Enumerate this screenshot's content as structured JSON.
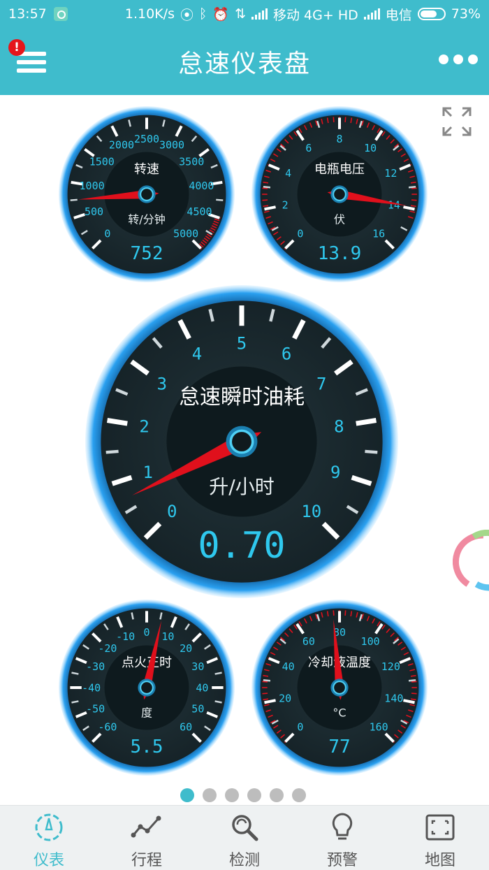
{
  "status_bar": {
    "time": "13:57",
    "net_speed": "1.10K/s",
    "carrier1": "移动 4G+ HD",
    "carrier2": "电信",
    "battery_pct": "73%",
    "battery_level": 0.73
  },
  "header": {
    "title": "怠速仪表盘",
    "notification_badge": "!"
  },
  "gauges": [
    {
      "id": "rpm",
      "label": "转速",
      "unit": "转/分钟",
      "reading": "752",
      "value": 752,
      "min": 0,
      "max": 5000,
      "ticks": [
        "0",
        "500",
        "1000",
        "1500",
        "2000",
        "2500",
        "3000",
        "3500",
        "4000",
        "4500",
        "5000"
      ],
      "redzone_from": 4500
    },
    {
      "id": "voltage",
      "label": "电瓶电压",
      "unit": "伏",
      "reading": "13.9",
      "value": 13.9,
      "min": 0,
      "max": 16,
      "ticks": [
        "0",
        "2",
        "4",
        "6",
        "8",
        "10",
        "12",
        "14",
        "16"
      ],
      "redzone_from": 0
    },
    {
      "id": "fuel",
      "label": "怠速瞬时油耗",
      "unit": "升/小时",
      "reading": "0.70",
      "value": 0.7,
      "min": 0,
      "max": 10,
      "ticks": [
        "0",
        "1",
        "2",
        "3",
        "4",
        "5",
        "6",
        "7",
        "8",
        "9",
        "10"
      ],
      "redzone_from": null
    },
    {
      "id": "ignition",
      "label": "点火正时",
      "unit": "度",
      "reading": "5.5",
      "value": 5.5,
      "min": -60,
      "max": 60,
      "ticks": [
        "-60",
        "-50",
        "-40",
        "-30",
        "-20",
        "-10",
        "0",
        "10",
        "20",
        "30",
        "40",
        "50",
        "60"
      ],
      "redzone_from": null
    },
    {
      "id": "coolant",
      "label": "冷却液温度",
      "unit": "°C",
      "reading": "77",
      "value": 77,
      "min": 0,
      "max": 160,
      "ticks": [
        "0",
        "20",
        "40",
        "60",
        "80",
        "100",
        "120",
        "140",
        "160"
      ],
      "redzone_from": 0
    }
  ],
  "pager": {
    "count": 6,
    "active": 0
  },
  "bottom_nav": [
    {
      "label": "仪表",
      "icon": "gauge-icon",
      "active": true
    },
    {
      "label": "行程",
      "icon": "trip-icon",
      "active": false
    },
    {
      "label": "检测",
      "icon": "search-check-icon",
      "active": false
    },
    {
      "label": "预警",
      "icon": "bulb-icon",
      "active": false
    },
    {
      "label": "地图",
      "icon": "map-icon",
      "active": false
    }
  ],
  "colors": {
    "primary": "#3fbccc",
    "digit": "#2fc8ee",
    "needle": "#e0101c",
    "dial": "#1d2b30"
  }
}
